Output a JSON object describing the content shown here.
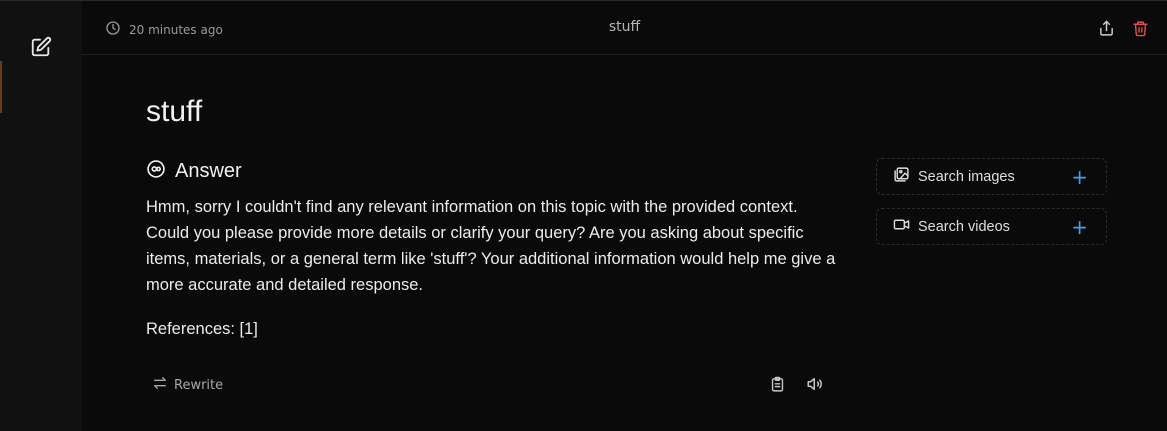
{
  "header": {
    "timestamp": "20 minutes ago",
    "title": "stuff",
    "share_icon": "share-icon",
    "delete_icon": "trash-icon",
    "delete_color": "#e05252"
  },
  "sidebar": {
    "compose_icon": "edit-icon"
  },
  "message": {
    "query": "stuff",
    "answer_label": "Answer",
    "answer_text": "Hmm, sorry I couldn't find any relevant information on this topic with the provided context. Could you please provide more details or clarify your query? Are you asking about specific items, materials, or a general term like 'stuff'? Your additional information would help me give a more accurate and detailed response.",
    "references": "References: [1]",
    "rewrite_label": "Rewrite",
    "copy_icon": "clipboard-icon",
    "speak_icon": "speaker-icon"
  },
  "side_panel": {
    "items": [
      {
        "label": "Search images",
        "icon": "image-icon",
        "action": "+"
      },
      {
        "label": "Search videos",
        "icon": "video-icon",
        "action": "+"
      }
    ],
    "accent_color": "#3d9ff5"
  }
}
